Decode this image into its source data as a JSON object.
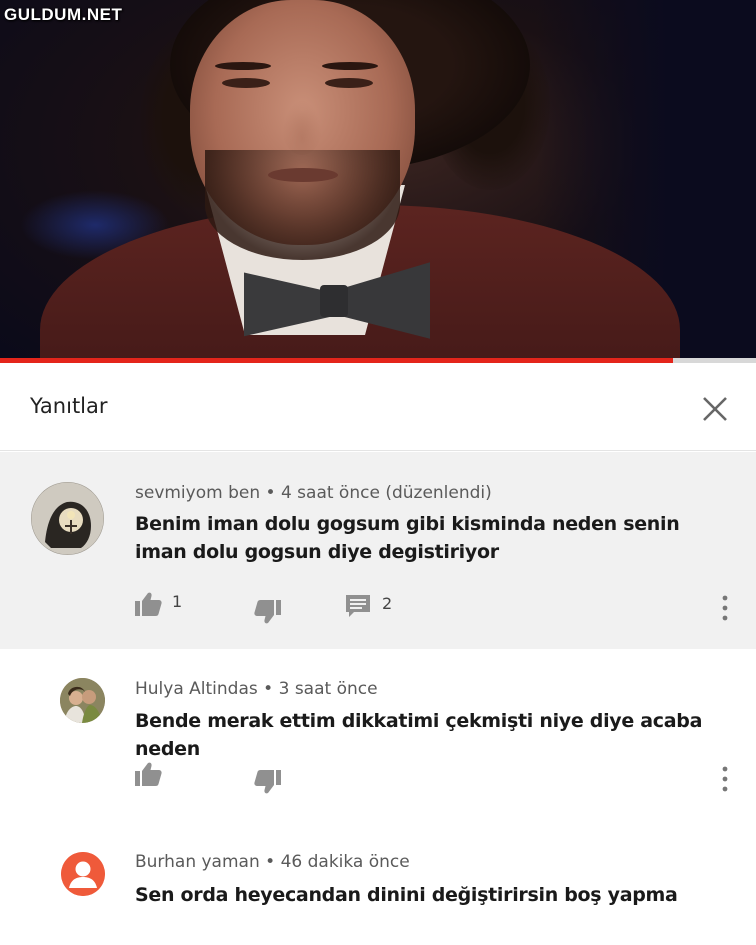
{
  "watermark": "GULDUM.NET",
  "video": {
    "progress_percent": 89,
    "progress_color": "#e4251b"
  },
  "header": {
    "title": "Yanıtlar"
  },
  "comments": [
    {
      "author": "sevmiyom ben",
      "time": "4 saat önce (düzenlendi)",
      "text": "Benim iman dolu gogsum gibi kisminda neden senin iman dolu gogsun diye degistiriyor",
      "likes": "1",
      "replies": "2",
      "avatar_icon": "profile-photo"
    },
    {
      "author": "Hulya Altindas",
      "time": "3 saat önce",
      "text": "Bende merak ettim dikkatimi çekmişti niye diye acaba neden",
      "avatar_icon": "profile-photo"
    },
    {
      "author": "Burhan yaman",
      "time": "46 dakika önce",
      "text": "Sen orda heyecandan dinini değiştirirsin boş yapma",
      "avatar_icon": "default-user-icon",
      "avatar_color": "#ef5a3a"
    }
  ],
  "separator": " • "
}
